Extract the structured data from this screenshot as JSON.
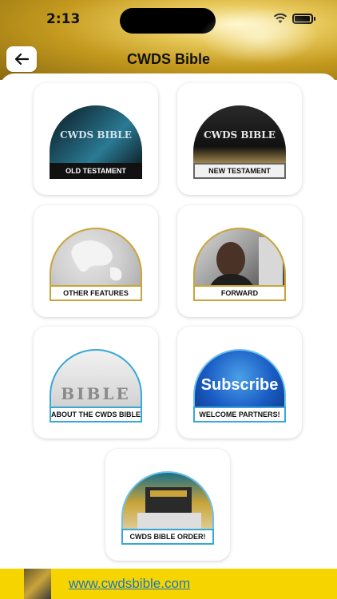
{
  "status_bar": {
    "time": "2:13"
  },
  "header": {
    "title": "CWDS Bible"
  },
  "menu": {
    "old_testament": {
      "label": "OLD TESTAMENT",
      "art_text": "CWDS BIBLE"
    },
    "new_testament": {
      "label": "NEW TESTAMENT",
      "art_text": "CWDS BIBLE"
    },
    "other_features": {
      "label": "OTHER FEATURES"
    },
    "forward": {
      "label": "FORWARD"
    },
    "about": {
      "label": "ABOUT THE CWDS BIBLE",
      "art_text": "BIBLE"
    },
    "welcome_partners": {
      "label": "WELCOME PARTNERS!",
      "art_text": "Subscribe"
    },
    "order": {
      "label": "CWDS BIBLE ORDER!"
    }
  },
  "footer": {
    "link_text": "www.cwdsbible.com"
  },
  "colors": {
    "accent_gold": "#c9a43a",
    "accent_blue": "#38a7d8",
    "footer_yellow": "#f5d400",
    "link_blue": "#1a76c0"
  }
}
